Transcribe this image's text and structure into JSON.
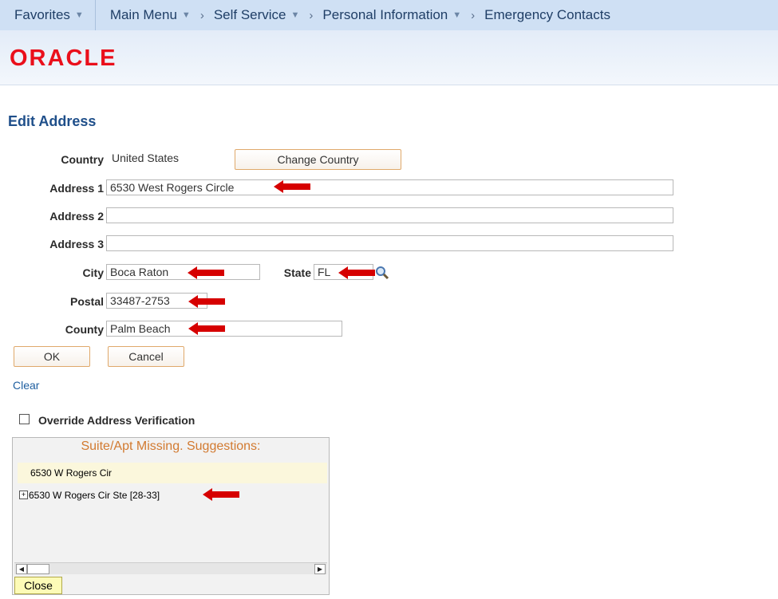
{
  "nav": {
    "favorites": "Favorites",
    "main_menu": "Main Menu",
    "self_service": "Self Service",
    "personal_info": "Personal Information",
    "emergency": "Emergency Contacts"
  },
  "brand": {
    "logo": "ORACLE",
    "logo_color": "#ea0f1b"
  },
  "page": {
    "title": "Edit Address"
  },
  "form": {
    "country_label": "Country",
    "country_value": "United States",
    "change_country": "Change Country",
    "address1_label": "Address 1",
    "address1_value": "6530 West Rogers Circle",
    "address2_label": "Address 2",
    "address2_value": "",
    "address3_label": "Address 3",
    "address3_value": "",
    "city_label": "City",
    "city_value": "Boca Raton",
    "state_label": "State",
    "state_value": "FL",
    "postal_label": "Postal",
    "postal_value": "33487-2753",
    "county_label": "County",
    "county_value": "Palm Beach"
  },
  "actions": {
    "ok": "OK",
    "cancel": "Cancel",
    "clear": "Clear"
  },
  "override": {
    "label": "Override Address Verification",
    "checked": false
  },
  "suggestions": {
    "title": "Suite/Apt Missing. Suggestions:",
    "items": [
      "6530 W Rogers Cir",
      "6530 W Rogers Cir Ste [28-33]"
    ],
    "close": "Close"
  },
  "icons": {
    "nav_caret": "chevron-down-icon",
    "nav_sep": "chevron-right-icon",
    "lookup": "magnifier-icon",
    "arrow": "red-arrow-left-icon",
    "expand": "plus-box-icon"
  },
  "colors": {
    "arrow": "#d60000",
    "title": "#1f4f8a",
    "suggestion_title": "#d27a30"
  }
}
